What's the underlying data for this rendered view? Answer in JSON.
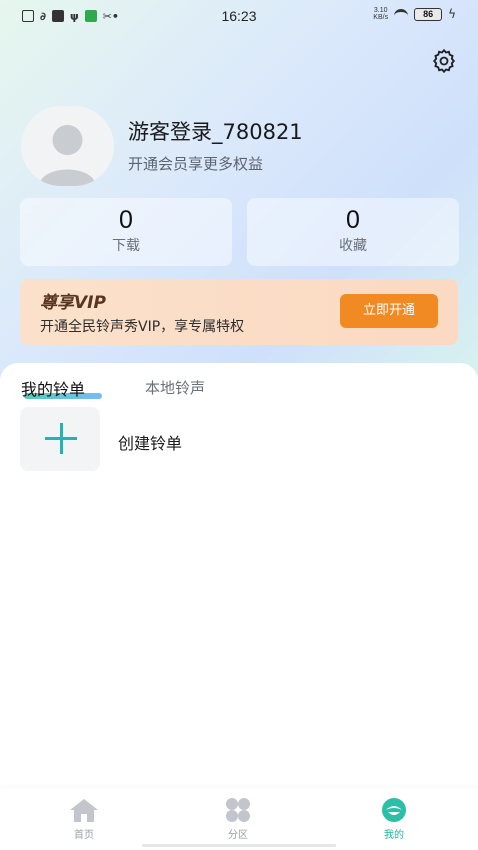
{
  "status_bar": {
    "time": "16:23",
    "net_speed_value": "3.10",
    "net_speed_unit": "KB/s",
    "battery": "86"
  },
  "profile": {
    "username": "游客登录_780821",
    "subtitle": "开通会员享更多权益"
  },
  "stats": [
    {
      "value": "0",
      "label": "下载"
    },
    {
      "value": "0",
      "label": "收藏"
    }
  ],
  "vip": {
    "title": "尊享VIP",
    "description": "开通全民铃声秀VIP，享专属特权",
    "button": "立即开通"
  },
  "tabs": [
    {
      "label": "我的铃单",
      "active": true
    },
    {
      "label": "本地铃声",
      "active": false
    }
  ],
  "create": {
    "label": "创建铃单",
    "icon": "plus-icon"
  },
  "bottom_nav": [
    {
      "label": "首页",
      "icon": "home-icon",
      "active": false
    },
    {
      "label": "分区",
      "icon": "grid-icon",
      "active": false
    },
    {
      "label": "我的",
      "icon": "profile-icon",
      "active": true
    }
  ],
  "colors": {
    "accent": "#23b39f",
    "vip_button": "#f28a24"
  }
}
